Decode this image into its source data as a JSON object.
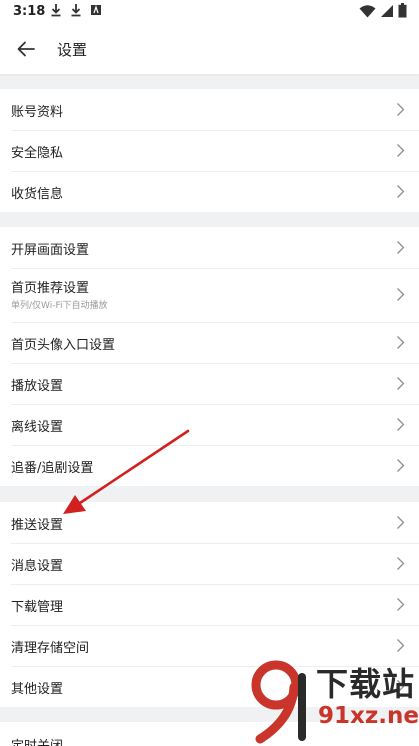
{
  "status_bar": {
    "time": "3:18"
  },
  "header": {
    "title": "设置"
  },
  "groups": [
    {
      "items": [
        {
          "label": "账号资料"
        },
        {
          "label": "安全隐私"
        },
        {
          "label": "收货信息"
        }
      ]
    },
    {
      "items": [
        {
          "label": "开屏画面设置"
        },
        {
          "label": "首页推荐设置",
          "sub": "单列/仅Wi-Fi下自动播放"
        },
        {
          "label": "首页头像入口设置"
        },
        {
          "label": "播放设置"
        },
        {
          "label": "离线设置"
        },
        {
          "label": "追番/追剧设置"
        }
      ]
    },
    {
      "items": [
        {
          "label": "推送设置"
        },
        {
          "label": "消息设置"
        },
        {
          "label": "下载管理"
        },
        {
          "label": "清理存储空间"
        },
        {
          "label": "其他设置"
        }
      ]
    },
    {
      "items": [
        {
          "label": "定时关闭"
        }
      ]
    }
  ],
  "watermark": {
    "title": "下载站",
    "url": "91xz.net"
  },
  "colors": {
    "annotation_arrow": "#d21f1f",
    "background": "#f0f1f3",
    "watermark_red": "#c9352b"
  }
}
